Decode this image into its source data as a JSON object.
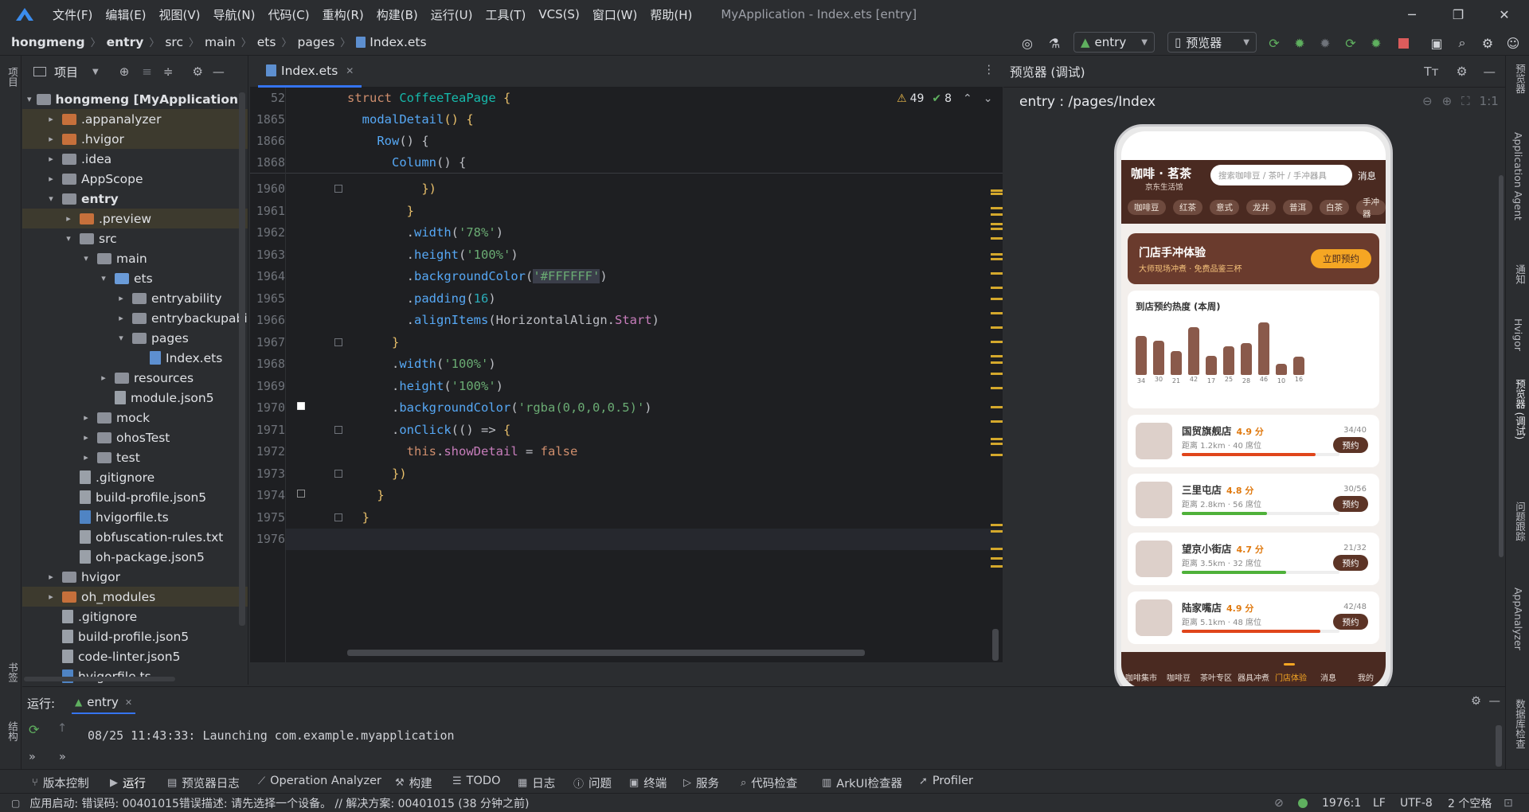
{
  "window": {
    "title": "MyApplication - Index.ets [entry]",
    "menu": [
      "文件(F)",
      "编辑(E)",
      "视图(V)",
      "导航(N)",
      "代码(C)",
      "重构(R)",
      "构建(B)",
      "运行(U)",
      "工具(T)",
      "VCS(S)",
      "窗口(W)",
      "帮助(H)"
    ]
  },
  "breadcrumb": [
    "hongmeng",
    "entry",
    "src",
    "main",
    "ets",
    "pages",
    "Index.ets"
  ],
  "toolbar": {
    "run_config": "entry",
    "device": "预览器"
  },
  "project_panel": {
    "title": "项目",
    "tree": [
      {
        "label": "hongmeng [MyApplication]",
        "suffix": "D:",
        "depth": 0,
        "arrow": "▾",
        "icon": "folder"
      },
      {
        "label": ".appanalyzer",
        "depth": 1,
        "arrow": "▸",
        "icon": "folder-orange"
      },
      {
        "label": ".hvigor",
        "depth": 1,
        "arrow": "▸",
        "icon": "folder-orange"
      },
      {
        "label": ".idea",
        "depth": 1,
        "arrow": "▸",
        "icon": "folder"
      },
      {
        "label": "AppScope",
        "depth": 1,
        "arrow": "▸",
        "icon": "folder"
      },
      {
        "label": "entry",
        "depth": 1,
        "arrow": "▾",
        "icon": "folder"
      },
      {
        "label": ".preview",
        "depth": 2,
        "arrow": "▸",
        "icon": "folder-orange"
      },
      {
        "label": "src",
        "depth": 2,
        "arrow": "▾",
        "icon": "folder"
      },
      {
        "label": "main",
        "depth": 3,
        "arrow": "▾",
        "icon": "folder"
      },
      {
        "label": "ets",
        "depth": 4,
        "arrow": "▾",
        "icon": "folder-blue"
      },
      {
        "label": "entryability",
        "depth": 5,
        "arrow": "▸",
        "icon": "folder"
      },
      {
        "label": "entrybackupabi",
        "depth": 5,
        "arrow": "▸",
        "icon": "folder"
      },
      {
        "label": "pages",
        "depth": 5,
        "arrow": "▾",
        "icon": "folder"
      },
      {
        "label": "Index.ets",
        "depth": 6,
        "arrow": "",
        "icon": "file-ets"
      },
      {
        "label": "resources",
        "depth": 4,
        "arrow": "▸",
        "icon": "folder"
      },
      {
        "label": "module.json5",
        "depth": 4,
        "arrow": "",
        "icon": "file-json"
      },
      {
        "label": "mock",
        "depth": 3,
        "arrow": "▸",
        "icon": "folder"
      },
      {
        "label": "ohosTest",
        "depth": 3,
        "arrow": "▸",
        "icon": "folder"
      },
      {
        "label": "test",
        "depth": 3,
        "arrow": "▸",
        "icon": "folder"
      },
      {
        "label": ".gitignore",
        "depth": 2,
        "arrow": "",
        "icon": "file-json"
      },
      {
        "label": "build-profile.json5",
        "depth": 2,
        "arrow": "",
        "icon": "file-json"
      },
      {
        "label": "hvigorfile.ts",
        "depth": 2,
        "arrow": "",
        "icon": "file-ts"
      },
      {
        "label": "obfuscation-rules.txt",
        "depth": 2,
        "arrow": "",
        "icon": "file-json"
      },
      {
        "label": "oh-package.json5",
        "depth": 2,
        "arrow": "",
        "icon": "file-json"
      },
      {
        "label": "hvigor",
        "depth": 1,
        "arrow": "▸",
        "icon": "folder"
      },
      {
        "label": "oh_modules",
        "depth": 1,
        "arrow": "▸",
        "icon": "folder-orange"
      },
      {
        "label": ".gitignore",
        "depth": 1,
        "arrow": "",
        "icon": "file-json"
      },
      {
        "label": "build-profile.json5",
        "depth": 1,
        "arrow": "",
        "icon": "file-json"
      },
      {
        "label": "code-linter.json5",
        "depth": 1,
        "arrow": "",
        "icon": "file-json"
      },
      {
        "label": "hvigorfile.ts",
        "depth": 1,
        "arrow": "",
        "icon": "file-ts"
      }
    ]
  },
  "editor": {
    "tab": "Index.ets",
    "warnings": "49",
    "checks": "8",
    "sticky": [
      {
        "ln": "52",
        "html": "<span class='kw'>struct</span> <span style='color:#16baac'>CoffeeTeaPage</span> <span class='yel'>{</span>"
      },
      {
        "ln": "1865",
        "html": "  <span class='fn'>modalDetail</span><span class='yel'>()</span> <span class='yel'>{</span>"
      },
      {
        "ln": "1866",
        "html": "    <span class='fn'>Row</span><span class='pl'>()</span> <span class='pl'>{</span>"
      },
      {
        "ln": "1868",
        "html": "      <span class='fn'>Column</span><span class='pl'>()</span> <span class='pl'>{</span>"
      }
    ],
    "lines": [
      {
        "ln": "1960",
        "html": "          <span class='yel'>})</span>"
      },
      {
        "ln": "1961",
        "html": "        <span class='yel'>}</span>"
      },
      {
        "ln": "1962",
        "html": "        .<span class='fn'>width</span>(<span class='str'>'78%'</span>)"
      },
      {
        "ln": "1963",
        "html": "        .<span class='fn'>height</span>(<span class='str'>'100%'</span>)"
      },
      {
        "ln": "1964",
        "html": "        .<span class='fn'>backgroundColor</span>(<span class='str' style='background:#3b3e4a'>'#FFFFFF'</span>)"
      },
      {
        "ln": "1965",
        "html": "        .<span class='fn'>padding</span>(<span class='num'>16</span>)"
      },
      {
        "ln": "1966",
        "html": "        .<span class='fn'>alignItems</span>(<span class='pl'>HorizontalAlign</span>.<span class='prop'>Start</span>)"
      },
      {
        "ln": "1967",
        "html": "      <span class='yel'>}</span>"
      },
      {
        "ln": "1968",
        "html": "      .<span class='fn'>width</span>(<span class='str'>'100%'</span>)"
      },
      {
        "ln": "1969",
        "html": "      .<span class='fn'>height</span>(<span class='str'>'100%'</span>)"
      },
      {
        "ln": "1970",
        "html": "      .<span class='fn'>backgroundColor</span>(<span class='str'>'rgba(0,0,0,0.5)'</span>)"
      },
      {
        "ln": "1971",
        "html": "      .<span class='fn'>onClick</span>(() => <span class='yel'>{</span>"
      },
      {
        "ln": "1972",
        "html": "        <span class='kw'>this</span>.<span class='prop'>showDetail</span> = <span class='kw'>false</span>"
      },
      {
        "ln": "1973",
        "html": "      <span class='yel'>})</span>"
      },
      {
        "ln": "1974",
        "html": "    <span class='yel'>}</span>"
      },
      {
        "ln": "1975",
        "html": "  <span class='yel'>}</span>"
      },
      {
        "ln": "1976",
        "html": ""
      }
    ]
  },
  "preview": {
    "panel_title": "预览器 (调试)",
    "route": "entry : /pages/Index",
    "zoom_label": "1:1",
    "app": {
      "brand": "咖啡 · 茗茶",
      "brand_sub": "京东生活馆",
      "search_placeholder": "搜索咖啡豆 / 茶叶 / 手冲器具",
      "msg": "消息",
      "chips": [
        "咖啡豆",
        "红茶",
        "意式",
        "龙井",
        "普洱",
        "白茶",
        "手冲器"
      ],
      "banner_title": "门店手冲体验",
      "banner_sub": "大师现场冲煮 · 免费品鉴三杯",
      "banner_btn": "立即预约",
      "chart_title": "到店预约热度 (本周)",
      "stores": [
        {
          "name": "国贸旗舰店",
          "rating": "4.9 分",
          "dist": "距离 1.2km · 40 席位",
          "count": "34/40",
          "btn": "预约",
          "fill": 0.85,
          "color": "#e0451b"
        },
        {
          "name": "三里屯店",
          "rating": "4.8 分",
          "dist": "距离 2.8km · 56 席位",
          "count": "30/56",
          "btn": "预约",
          "fill": 0.54,
          "color": "#4fb13a"
        },
        {
          "name": "望京小街店",
          "rating": "4.7 分",
          "dist": "距离 3.5km · 32 席位",
          "count": "21/32",
          "btn": "预约",
          "fill": 0.66,
          "color": "#4fb13a"
        },
        {
          "name": "陆家嘴店",
          "rating": "4.9 分",
          "dist": "距离 5.1km · 48 席位",
          "count": "42/48",
          "btn": "预约",
          "fill": 0.88,
          "color": "#e0451b"
        }
      ],
      "tabs": [
        "咖啡集市",
        "咖啡豆",
        "茶叶专区",
        "器具冲煮",
        "门店体验",
        "消息",
        "我的"
      ],
      "active_tab": 4
    }
  },
  "chart_data": {
    "type": "bar",
    "title": "到店预约热度 (本周)",
    "values": [
      34,
      30,
      21,
      42,
      17,
      25,
      28,
      46,
      10,
      16
    ],
    "ylim": [
      0,
      46
    ]
  },
  "run_panel": {
    "label": "运行:",
    "tab": "entry",
    "log": "08/25 11:43:33: Launching com.example.myapplication"
  },
  "tool_windows": [
    "版本控制",
    "运行",
    "预览器日志",
    "Operation Analyzer",
    "构建",
    "TODO",
    "日志",
    "问题",
    "终端",
    "服务",
    "代码检查",
    "ArkUI检查器",
    "Profiler"
  ],
  "side_tools_left": [
    "项目",
    "书签",
    "结构"
  ],
  "side_tools_right": [
    "预览器",
    "Application Agent",
    "通知",
    "Hvigor",
    "预览器 (调试)",
    "问题跟踪",
    "AppAnalyzer",
    "数据库检查"
  ],
  "status": {
    "message": "应用启动: 错误码: 00401015错误描述: 请先选择一个设备。 // 解决方案: 00401015 (38 分钟之前)",
    "position": "1976:1",
    "line_sep": "LF",
    "encoding": "UTF-8",
    "indent": "2 个空格"
  },
  "colors": {
    "accent": "#3574f0",
    "app_brown": "#4a2a21",
    "bar": "#8a5a4b",
    "banner_btn": "#f5a623"
  }
}
